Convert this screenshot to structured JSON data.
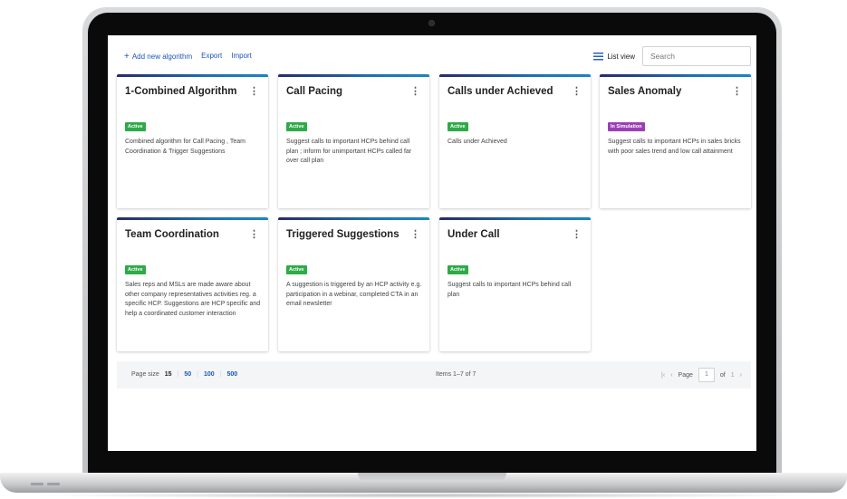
{
  "toolbar": {
    "add_label": "Add new algorithm",
    "export_label": "Export",
    "import_label": "Import",
    "list_view_label": "List view",
    "search_placeholder": "Search"
  },
  "colors": {
    "link": "#1a56b8",
    "active_badge": "#2eaa48",
    "simulation_badge": "#9b3fb5"
  },
  "cards": [
    {
      "title": "1-Combined Algorithm",
      "status": "Active",
      "description": "Combined algorithm for Call Pacing , Team Coordination & Trigger Suggestions"
    },
    {
      "title": "Call Pacing",
      "status": "Active",
      "description": "Suggest calls to important HCPs behind call plan ; inform for unimportant HCPs called far over call plan"
    },
    {
      "title": "Calls under Achieved",
      "status": "Active",
      "description": "Calls under Achieved"
    },
    {
      "title": "Sales Anomaly",
      "status": "In Simulation",
      "description": "Suggest calls to important HCPs in sales bricks with poor sales trend and low call attainment"
    },
    {
      "title": "Team Coordination",
      "status": "Active",
      "description": "Sales reps and MSLs are made aware about other company representatives activities reg. a specific HCP. Suggestions are HCP specific and help a coordinated customer interaction"
    },
    {
      "title": "Triggered Suggestions",
      "status": "Active",
      "description": "A suggestion is triggered by an HCP activity e.g. participation in a webinar, completed CTA in an email newsletter"
    },
    {
      "title": "Under Call",
      "status": "Active",
      "description": "Suggest calls to important HCPs behind call plan"
    }
  ],
  "pager": {
    "page_size_label": "Page size",
    "sizes": [
      "15",
      "50",
      "100",
      "500"
    ],
    "items_text": "Items 1–7 of 7",
    "page_label": "Page",
    "page_value": "1",
    "of_label": "of",
    "total_pages": "1"
  }
}
